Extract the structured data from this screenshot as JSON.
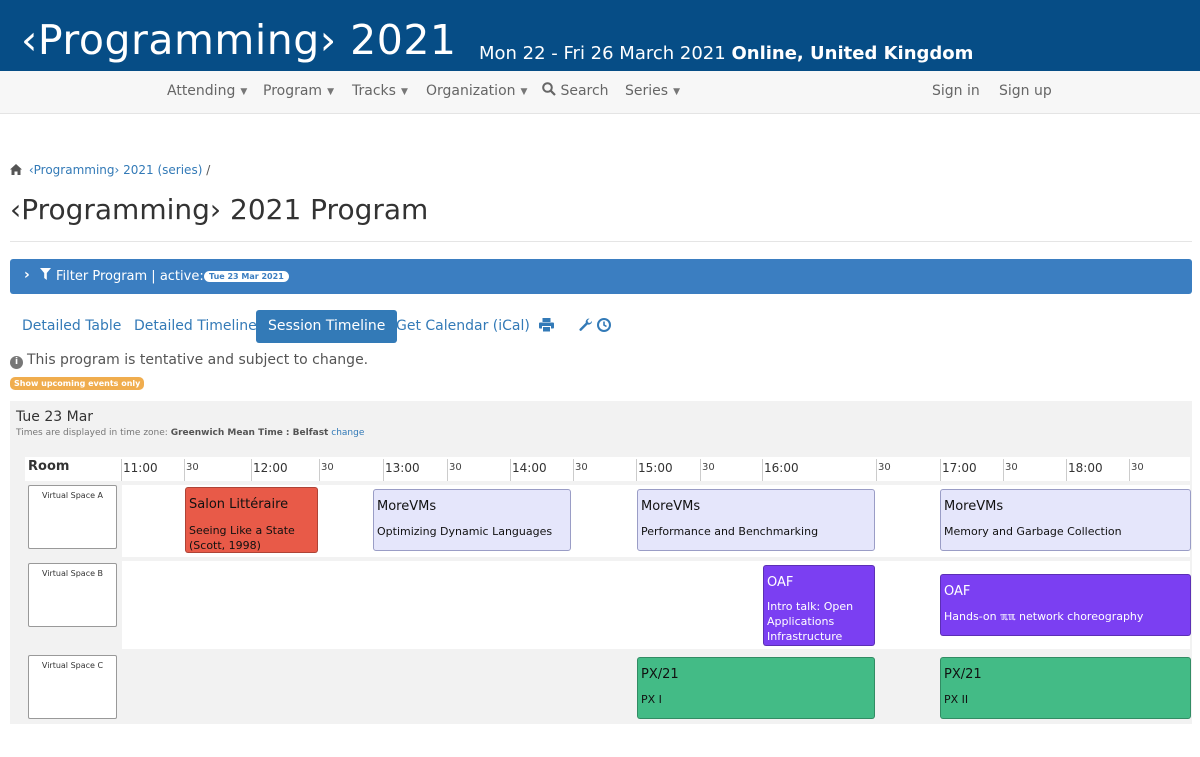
{
  "header": {
    "brand": "‹Programming› 2021",
    "dates": "Mon 22 - Fri 26 March 2021",
    "location": "Online, United Kingdom"
  },
  "nav": {
    "attending": "Attending",
    "program": "Program",
    "tracks": "Tracks",
    "organization": "Organization",
    "search": "Search",
    "series": "Series",
    "sign_in": "Sign in",
    "sign_up": "Sign up"
  },
  "breadcrumb": {
    "link": "‹Programming› 2021 (series)",
    "sep": "/"
  },
  "page_title": "‹Programming› 2021 Program",
  "filter": {
    "label": "Filter Program | active:",
    "badge": "Tue 23 Mar 2021"
  },
  "tabs": {
    "detailed_table": "Detailed Table",
    "detailed_timeline": "Detailed Timeline",
    "session_timeline": "Session Timeline",
    "ical": "Get Calendar (iCal)"
  },
  "icons": [
    "print-icon",
    "wrench-icon",
    "clock-icon",
    "info-icon",
    "home-icon",
    "filter-icon",
    "chevron-right-icon",
    "search-icon"
  ],
  "notice": "This program is tentative and subject to change.",
  "upcoming_button": "Show upcoming events only",
  "timeline": {
    "day": "Tue 23 Mar",
    "tz_prefix": "Times are displayed in time zone:",
    "tz_name": "Greenwich Mean Time : Belfast",
    "tz_change": "change",
    "room_header": "Room",
    "ticks": {
      "t1100": "11:00",
      "h1130": "30",
      "t1200": "12:00",
      "h1230": "30",
      "t1300": "13:00",
      "h1330": "30",
      "t1400": "14:00",
      "h1430": "30",
      "t1500": "15:00",
      "h1530": "30",
      "t1600": "16:00",
      "h1630": "30",
      "t1700": "17:00",
      "h1730": "30",
      "t1800": "18:00",
      "h1830": "30"
    },
    "rooms": {
      "a": "Virtual Space A",
      "b": "Virtual Space B",
      "c": "Virtual Space C"
    },
    "events": {
      "salon": {
        "track": "Salon Littéraire",
        "title": "Seeing Like a State (Scott, 1998)"
      },
      "morevms1": {
        "track": "MoreVMs",
        "title": "Optimizing Dynamic Languages"
      },
      "morevms2": {
        "track": "MoreVMs",
        "title": "Performance and Benchmarking"
      },
      "morevms3": {
        "track": "MoreVMs",
        "title": "Memory and Garbage Collection"
      },
      "oaf1": {
        "track": "OAF",
        "title": "Intro talk: Open Applications Infrastructure"
      },
      "oaf2": {
        "track": "OAF",
        "title": "Hands-on ℼℼ network choreography"
      },
      "px1": {
        "track": "PX/21",
        "title": "PX I"
      },
      "px2": {
        "track": "PX/21",
        "title": "PX II"
      }
    }
  },
  "colors": {
    "header_bg": "#064d86",
    "accent": "#337ab7",
    "salon": "#e85a48",
    "morevms": "#e5e6fb",
    "oaf": "#7b3ff2",
    "px": "#43bb86",
    "upcoming": "#f0ad4e"
  }
}
